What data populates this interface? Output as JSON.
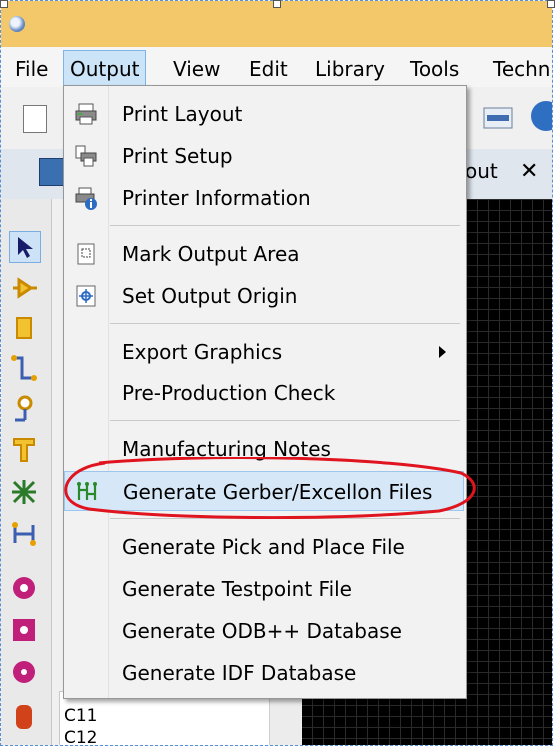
{
  "menubar": {
    "items": [
      "File",
      "Output",
      "View",
      "Edit",
      "Library",
      "Tools",
      "Techn"
    ],
    "active": "Output"
  },
  "tab": {
    "label": "out",
    "close": "✕"
  },
  "output_menu": {
    "groups": [
      [
        {
          "label": "Print Layout",
          "icon": "printer-icon"
        },
        {
          "label": "Print Setup",
          "icon": "print-setup-icon"
        },
        {
          "label": "Printer Information",
          "icon": "printer-info-icon"
        }
      ],
      [
        {
          "label": "Mark Output Area",
          "icon": "mark-area-icon"
        },
        {
          "label": "Set Output Origin",
          "icon": "origin-icon"
        }
      ],
      [
        {
          "label": "Export Graphics",
          "has_submenu": true
        },
        {
          "label": "Pre-Production Check"
        }
      ],
      [
        {
          "label": "Manufacturing Notes"
        },
        {
          "label": "Generate Gerber/Excellon Files",
          "icon": "gerber-icon",
          "highlighted": true
        }
      ],
      [
        {
          "label": "Generate Pick and Place File"
        },
        {
          "label": "Generate Testpoint File"
        },
        {
          "label": "Generate ODB++ Database"
        },
        {
          "label": "Generate IDF Database"
        }
      ]
    ]
  },
  "component_list": [
    "C11",
    "C12"
  ],
  "colors": {
    "titlebar": "#f3c86a",
    "menu_highlight": "#d6e8f7",
    "annotation": "#e0141e"
  }
}
